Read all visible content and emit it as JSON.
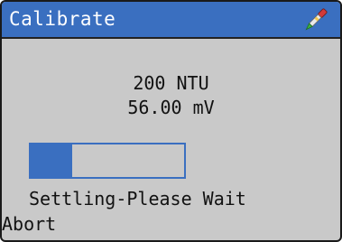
{
  "header": {
    "title": "Calibrate",
    "icon": "probe-icon"
  },
  "readings": {
    "standard": "200 NTU",
    "signal": "56.00 mV"
  },
  "progress": {
    "fraction": 0.27,
    "fill_color": "#3a6fc0"
  },
  "status": {
    "message": "Settling-Please Wait"
  },
  "softkeys": {
    "left_label": "Abort"
  },
  "colors": {
    "titlebar": "#3a6fc0",
    "background": "#c9c9c9",
    "text": "#111111"
  }
}
